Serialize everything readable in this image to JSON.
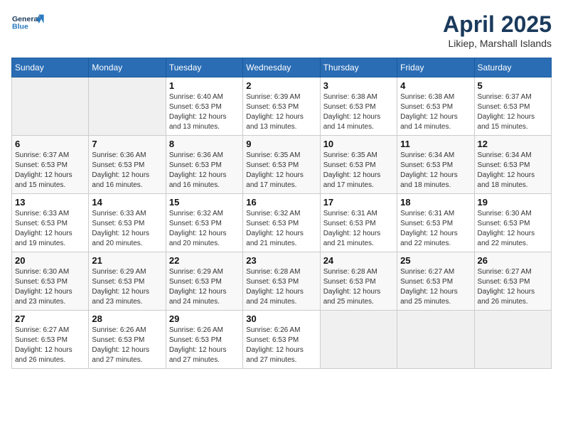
{
  "header": {
    "logo_line1": "General",
    "logo_line2": "Blue",
    "month_year": "April 2025",
    "location": "Likiep, Marshall Islands"
  },
  "weekdays": [
    "Sunday",
    "Monday",
    "Tuesday",
    "Wednesday",
    "Thursday",
    "Friday",
    "Saturday"
  ],
  "weeks": [
    [
      {
        "day": "",
        "info": ""
      },
      {
        "day": "",
        "info": ""
      },
      {
        "day": "1",
        "info": "Sunrise: 6:40 AM\nSunset: 6:53 PM\nDaylight: 12 hours and 13 minutes."
      },
      {
        "day": "2",
        "info": "Sunrise: 6:39 AM\nSunset: 6:53 PM\nDaylight: 12 hours and 13 minutes."
      },
      {
        "day": "3",
        "info": "Sunrise: 6:38 AM\nSunset: 6:53 PM\nDaylight: 12 hours and 14 minutes."
      },
      {
        "day": "4",
        "info": "Sunrise: 6:38 AM\nSunset: 6:53 PM\nDaylight: 12 hours and 14 minutes."
      },
      {
        "day": "5",
        "info": "Sunrise: 6:37 AM\nSunset: 6:53 PM\nDaylight: 12 hours and 15 minutes."
      }
    ],
    [
      {
        "day": "6",
        "info": "Sunrise: 6:37 AM\nSunset: 6:53 PM\nDaylight: 12 hours and 15 minutes."
      },
      {
        "day": "7",
        "info": "Sunrise: 6:36 AM\nSunset: 6:53 PM\nDaylight: 12 hours and 16 minutes."
      },
      {
        "day": "8",
        "info": "Sunrise: 6:36 AM\nSunset: 6:53 PM\nDaylight: 12 hours and 16 minutes."
      },
      {
        "day": "9",
        "info": "Sunrise: 6:35 AM\nSunset: 6:53 PM\nDaylight: 12 hours and 17 minutes."
      },
      {
        "day": "10",
        "info": "Sunrise: 6:35 AM\nSunset: 6:53 PM\nDaylight: 12 hours and 17 minutes."
      },
      {
        "day": "11",
        "info": "Sunrise: 6:34 AM\nSunset: 6:53 PM\nDaylight: 12 hours and 18 minutes."
      },
      {
        "day": "12",
        "info": "Sunrise: 6:34 AM\nSunset: 6:53 PM\nDaylight: 12 hours and 18 minutes."
      }
    ],
    [
      {
        "day": "13",
        "info": "Sunrise: 6:33 AM\nSunset: 6:53 PM\nDaylight: 12 hours and 19 minutes."
      },
      {
        "day": "14",
        "info": "Sunrise: 6:33 AM\nSunset: 6:53 PM\nDaylight: 12 hours and 20 minutes."
      },
      {
        "day": "15",
        "info": "Sunrise: 6:32 AM\nSunset: 6:53 PM\nDaylight: 12 hours and 20 minutes."
      },
      {
        "day": "16",
        "info": "Sunrise: 6:32 AM\nSunset: 6:53 PM\nDaylight: 12 hours and 21 minutes."
      },
      {
        "day": "17",
        "info": "Sunrise: 6:31 AM\nSunset: 6:53 PM\nDaylight: 12 hours and 21 minutes."
      },
      {
        "day": "18",
        "info": "Sunrise: 6:31 AM\nSunset: 6:53 PM\nDaylight: 12 hours and 22 minutes."
      },
      {
        "day": "19",
        "info": "Sunrise: 6:30 AM\nSunset: 6:53 PM\nDaylight: 12 hours and 22 minutes."
      }
    ],
    [
      {
        "day": "20",
        "info": "Sunrise: 6:30 AM\nSunset: 6:53 PM\nDaylight: 12 hours and 23 minutes."
      },
      {
        "day": "21",
        "info": "Sunrise: 6:29 AM\nSunset: 6:53 PM\nDaylight: 12 hours and 23 minutes."
      },
      {
        "day": "22",
        "info": "Sunrise: 6:29 AM\nSunset: 6:53 PM\nDaylight: 12 hours and 24 minutes."
      },
      {
        "day": "23",
        "info": "Sunrise: 6:28 AM\nSunset: 6:53 PM\nDaylight: 12 hours and 24 minutes."
      },
      {
        "day": "24",
        "info": "Sunrise: 6:28 AM\nSunset: 6:53 PM\nDaylight: 12 hours and 25 minutes."
      },
      {
        "day": "25",
        "info": "Sunrise: 6:27 AM\nSunset: 6:53 PM\nDaylight: 12 hours and 25 minutes."
      },
      {
        "day": "26",
        "info": "Sunrise: 6:27 AM\nSunset: 6:53 PM\nDaylight: 12 hours and 26 minutes."
      }
    ],
    [
      {
        "day": "27",
        "info": "Sunrise: 6:27 AM\nSunset: 6:53 PM\nDaylight: 12 hours and 26 minutes."
      },
      {
        "day": "28",
        "info": "Sunrise: 6:26 AM\nSunset: 6:53 PM\nDaylight: 12 hours and 27 minutes."
      },
      {
        "day": "29",
        "info": "Sunrise: 6:26 AM\nSunset: 6:53 PM\nDaylight: 12 hours and 27 minutes."
      },
      {
        "day": "30",
        "info": "Sunrise: 6:26 AM\nSunset: 6:53 PM\nDaylight: 12 hours and 27 minutes."
      },
      {
        "day": "",
        "info": ""
      },
      {
        "day": "",
        "info": ""
      },
      {
        "day": "",
        "info": ""
      }
    ]
  ]
}
